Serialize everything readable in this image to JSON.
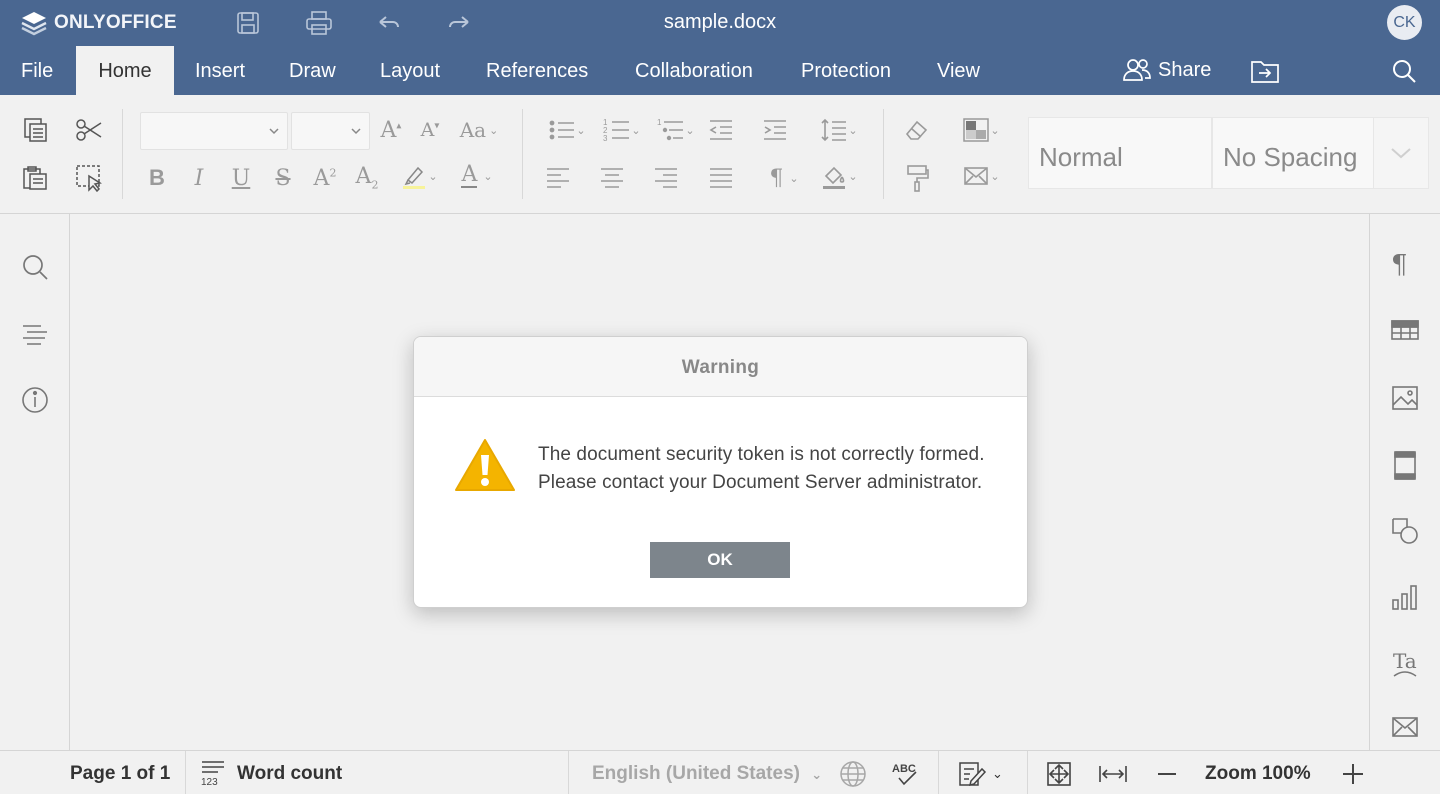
{
  "titlebar": {
    "brand": "ONLYOFFICE",
    "document_title": "sample.docx",
    "user_initials": "CK"
  },
  "tabs": [
    "File",
    "Home",
    "Insert",
    "Draw",
    "Layout",
    "References",
    "Collaboration",
    "Protection",
    "View"
  ],
  "active_tab": "Home",
  "actions": {
    "share_label": "Share"
  },
  "toolbar": {
    "font_name": "",
    "font_size": "",
    "styles": [
      "Normal",
      "No Spacing"
    ]
  },
  "dialog": {
    "title": "Warning",
    "message_line1": "The document security token is not correctly formed.",
    "message_line2": "Please contact your Document Server administrator.",
    "ok_label": "OK"
  },
  "statusbar": {
    "page_info": "Page 1 of 1",
    "word_count": "Word count",
    "language": "English (United States)",
    "zoom": "Zoom 100%"
  },
  "colors": {
    "header": "#4a6791",
    "background": "#f1f1f1",
    "ok_button": "#7d858c",
    "warning": "#f4b400"
  }
}
